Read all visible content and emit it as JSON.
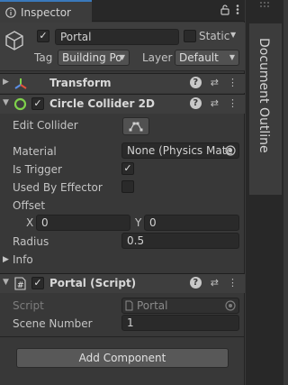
{
  "inspector": {
    "tab_title": "Inspector",
    "object": {
      "active": true,
      "name": "Portal",
      "static_label": "Static",
      "static_checked": false,
      "tag_label": "Tag",
      "tag_value": "Building Po",
      "layer_label": "Layer",
      "layer_value": "Default"
    },
    "components": {
      "transform": {
        "title": "Transform"
      },
      "circle_collider": {
        "title": "Circle Collider 2D",
        "enabled": true,
        "edit_collider_label": "Edit Collider",
        "material_label": "Material",
        "material_value": "None (Physics Mate",
        "is_trigger_label": "Is Trigger",
        "is_trigger_checked": true,
        "used_by_effector_label": "Used By Effector",
        "used_by_effector_checked": false,
        "offset_label": "Offset",
        "offset_x_label": "X",
        "offset_x": "0",
        "offset_y_label": "Y",
        "offset_y": "0",
        "radius_label": "Radius",
        "radius_value": "0.5",
        "info_label": "Info"
      },
      "portal_script": {
        "title": "Portal (Script)",
        "script_label": "Script",
        "script_value": "Portal",
        "scene_number_label": "Scene Number",
        "scene_number_value": "1"
      }
    },
    "add_component_label": "Add Component"
  },
  "side_panel": {
    "title": "Document Outline"
  },
  "colors": {
    "background": "#383838",
    "header": "#3e3e3e",
    "field": "#2a2a2a",
    "accent_tab": "#3a79bb",
    "collider_green": "#7fd14b",
    "transform_red": "#e0513c",
    "transform_blue": "#5b8ee6"
  },
  "icons": [
    "lock-icon",
    "kebab-menu-icon",
    "gameobject-cube-icon",
    "transform-axis-icon",
    "circle-collider-icon",
    "script-icon",
    "help-icon",
    "preset-icon",
    "object-picker-icon",
    "edit-collider-icon"
  ]
}
